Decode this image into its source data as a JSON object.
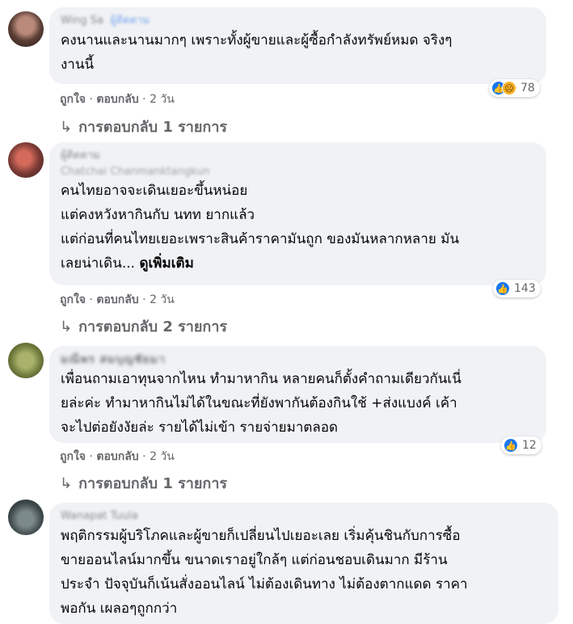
{
  "comments": [
    {
      "author": "Wing Sa",
      "author_tag": "ผู้ติดตาม",
      "lines": [
        "คงนานและนานมากๆ เพราะทั้งผู้ขายและผู้ซื้อกำลังทรัพย์หมด จริงๆ",
        "งานนี้"
      ],
      "reaction_count": "78",
      "like": "ถูกใจ",
      "reply": "ตอบกลับ",
      "time": "2 วัน",
      "replies_label": "การตอบกลับ 1 รายการ"
    },
    {
      "author": "ผู้ติดตาม",
      "author_sub": "Chatchai Chanmanktangkun",
      "lines": [
        "คนไทยอาจจะเดินเยอะขึ้นหน่อย",
        "แต่คงหวังหากินกับ นทท ยากแล้ว",
        "แต่ก่อนที่คนไทยเยอะเพราะสินค้าราคามันถูก ของมันหลากหลาย มัน",
        "เลยน่าเดิน..."
      ],
      "see_more": "ดูเพิ่มเติม",
      "reaction_count": "143",
      "like": "ถูกใจ",
      "reply": "ตอบกลับ",
      "time": "2 วัน",
      "replies_label": "การตอบกลับ 2 รายการ"
    },
    {
      "author": "มณีพร สมบุญชัยมา",
      "lines": [
        "เพื่อนถามเอาทุนจากไหน ทำมาหากิน หลายคนก็ตั้งคำถามเดียวกันเนี่",
        "ยล่ะค่ะ ทำมาหากินไม่ได้ในขณะที่ยังพากันต้องกินใช้ +ส่งแบงค์ เค้า",
        "จะไปต่อยังงัยล่ะ รายได้ไม่เข้า รายจ่ายมาตลอด"
      ],
      "reaction_count": "12",
      "like": "ถูกใจ",
      "reply": "ตอบกลับ",
      "time": "2 วัน",
      "replies_label": "การตอบกลับ 1 รายการ"
    },
    {
      "author": "Wanapat Tuula",
      "lines": [
        "พฤติกรรมผู้บริโภคและผู้ขายก็เปลี่ยนไปเยอะเลย เริ่มคุ้นชินกับการซื้อ",
        "ขายออนไลน์มากขึ้น ขนาดเราอยู่ใกล้ๆ แต่ก่อนชอบเดินมาก มีร้าน",
        "ประจำ ปัจจุบันก็เน้นสั่งออนไลน์ ไม่ต้องเดินทาง ไม่ต้องตากแดด ราคา",
        "พอกัน เผลอๆถูกกว่า"
      ]
    }
  ],
  "colors": {
    "bubble": "#f0f2f5",
    "like_blue": "#1877f2",
    "sad_yellow": "#f7b125",
    "meta_gray": "#65676b"
  },
  "icons": [
    "like-icon",
    "sad-icon",
    "reply-arrow-icon"
  ]
}
